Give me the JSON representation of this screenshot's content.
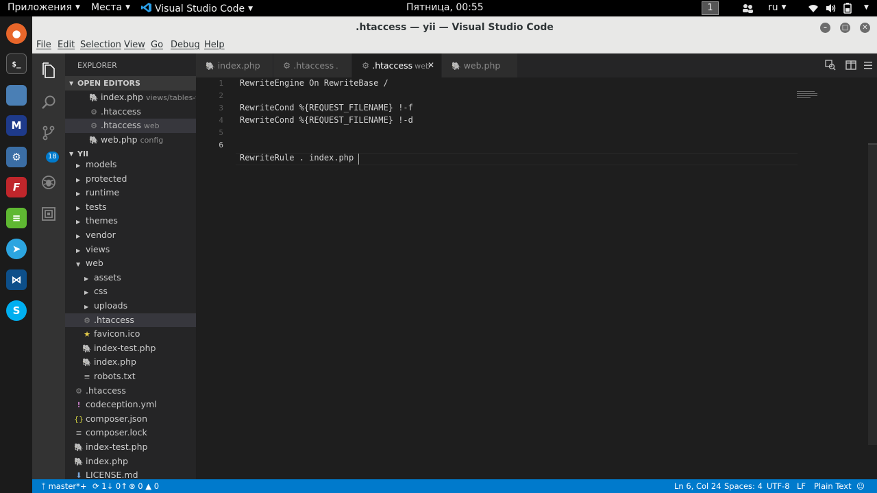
{
  "system_bar": {
    "apps_menu": "Приложения",
    "places_menu": "Места",
    "active_app": "Visual Studio Code",
    "clock": "Пятница, 00:55",
    "workspace": "1",
    "keyboard_layout": "ru"
  },
  "dock": {
    "icons": [
      "firefox-icon",
      "terminal-icon",
      "files-icon",
      "malwarebytes-icon",
      "system-tool-icon",
      "filezilla-icon",
      "text-editor-icon",
      "telegram-icon",
      "vscode-icon",
      "skype-icon"
    ]
  },
  "window": {
    "title": ".htaccess — yii — Visual Studio Code"
  },
  "menu": [
    "File",
    "Edit",
    "Selection",
    "View",
    "Go",
    "Debug",
    "Help"
  ],
  "activity_bar": {
    "scm_badge": "18"
  },
  "explorer": {
    "title": "EXPLORER",
    "open_editors_header": "OPEN EDITORS",
    "open_editors": [
      {
        "name": "index.php",
        "desc": "views/tables-tbl",
        "icon": "php-icon"
      },
      {
        "name": ".htaccess",
        "desc": "",
        "icon": "gear-icon"
      },
      {
        "name": ".htaccess",
        "desc": "web",
        "icon": "gear-icon",
        "selected": true
      },
      {
        "name": "web.php",
        "desc": "config",
        "icon": "php-icon"
      }
    ],
    "project_header": "YII",
    "tree": [
      {
        "name": "models"
      },
      {
        "name": "protected"
      },
      {
        "name": "runtime"
      },
      {
        "name": "tests"
      },
      {
        "name": "themes"
      },
      {
        "name": "vendor"
      },
      {
        "name": "views"
      },
      {
        "name": "web"
      },
      {
        "name": "assets"
      },
      {
        "name": "css"
      },
      {
        "name": "uploads"
      },
      {
        "name": ".htaccess"
      },
      {
        "name": "favicon.ico"
      },
      {
        "name": "index-test.php"
      },
      {
        "name": "index.php"
      },
      {
        "name": "robots.txt"
      },
      {
        "name": ".htaccess"
      },
      {
        "name": "codeception.yml"
      },
      {
        "name": "composer.json"
      },
      {
        "name": "composer.lock"
      },
      {
        "name": "index-test.php"
      },
      {
        "name": "index.php"
      },
      {
        "name": "LICENSE.md"
      }
    ]
  },
  "tabs": [
    {
      "label": "index.php",
      "desc": "",
      "icon": "php-icon"
    },
    {
      "label": ".htaccess",
      "desc": ".",
      "icon": "gear-icon"
    },
    {
      "label": ".htaccess",
      "desc": "web",
      "icon": "gear-icon",
      "active": true
    },
    {
      "label": "web.php",
      "desc": "",
      "icon": "php-icon"
    }
  ],
  "editor": {
    "line_numbers": [
      "1",
      "2",
      "3",
      "4",
      "5",
      "6"
    ],
    "lines": [
      "RewriteEngine On RewriteBase /",
      "",
      "RewriteCond %{REQUEST_FILENAME} !-f",
      "RewriteCond %{REQUEST_FILENAME} !-d",
      "",
      "RewriteRule . index.php"
    ]
  },
  "status": {
    "branch": "master*+",
    "sync": "1↓ 0↑",
    "errors": "0",
    "warnings": "0",
    "cursor_pos": "Ln 6, Col 24",
    "indent": "Spaces: 4",
    "encoding": "UTF-8",
    "eol": "LF",
    "language": "Plain Text"
  },
  "colors": {
    "status_bar": "#007acc",
    "editor_bg": "#1e1e1e",
    "sidebar_bg": "#252526",
    "activity_bar": "#333333"
  }
}
